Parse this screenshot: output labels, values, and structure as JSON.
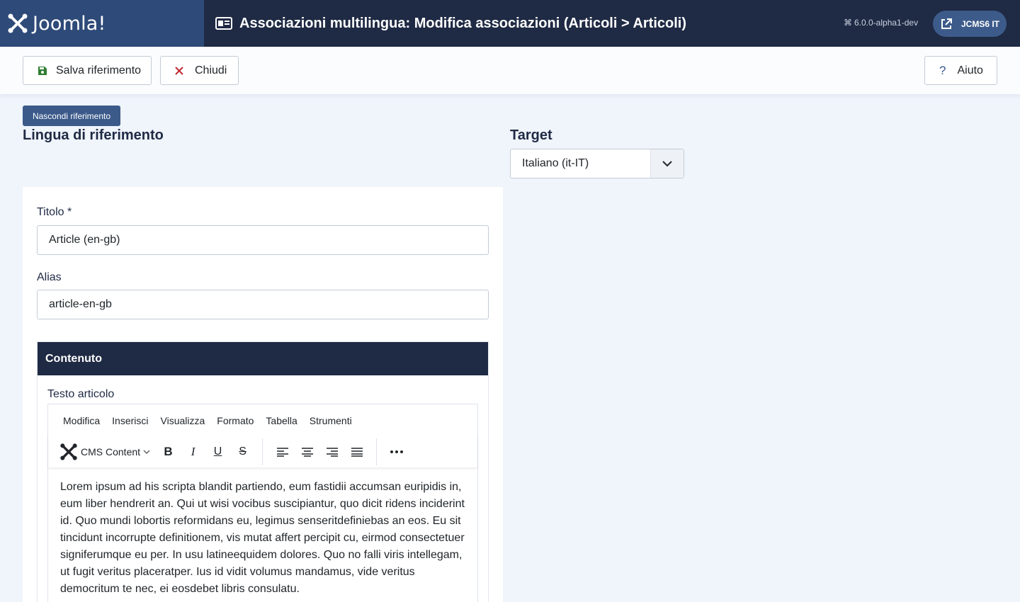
{
  "header": {
    "logo_text": "Joomla!",
    "page_title": "Associazioni multilingua: Modifica associazioni (Articoli > Articoli)",
    "version": "6.0.0-alpha1-dev",
    "site_button": "JCMS6 IT"
  },
  "toolbar": {
    "save_label": "Salva riferimento",
    "close_label": "Chiudi",
    "help_label": "Aiuto"
  },
  "reference": {
    "hide_button": "Nascondi riferimento",
    "heading": "Lingua di riferimento"
  },
  "target": {
    "heading": "Target",
    "selected": "Italiano (it-IT)"
  },
  "form": {
    "title_label": "Titolo *",
    "title_value": "Article (en-gb)",
    "alias_label": "Alias",
    "alias_value": "article-en-gb",
    "content_tab": "Contenuto",
    "editor_label": "Testo articolo"
  },
  "editor": {
    "menus": [
      "Modifica",
      "Inserisci",
      "Visualizza",
      "Formato",
      "Tabella",
      "Strumenti"
    ],
    "cms_content": "CMS Content",
    "body": "Lorem ipsum ad his scripta blandit partiendo, eum fastidii accumsan euripidis in, eum liber hendrerit an. Qui ut wisi vocibus suscipiantur, quo dicit ridens inciderint id. Quo mundi lobortis reformidans eu, legimus senseritdefiniebas an eos. Eu sit tincidunt incorrupte definitionem, vis mutat affert percipit cu, eirmod consectetuer signiferumque eu per. In usu latineequidem dolores. Quo no falli viris intellegam, ut fugit veritus placeratper. Ius id vidit volumus mandamus, vide veritus democritum te nec, ei eosdebet libris consulatu."
  },
  "colors": {
    "header_bg": "#1f2a44",
    "logo_bg": "#2e4a78",
    "accent": "#3b5a8a",
    "save_icon": "#2f7d32",
    "close_icon": "#c0262e",
    "help_icon": "#3b5a8a"
  }
}
